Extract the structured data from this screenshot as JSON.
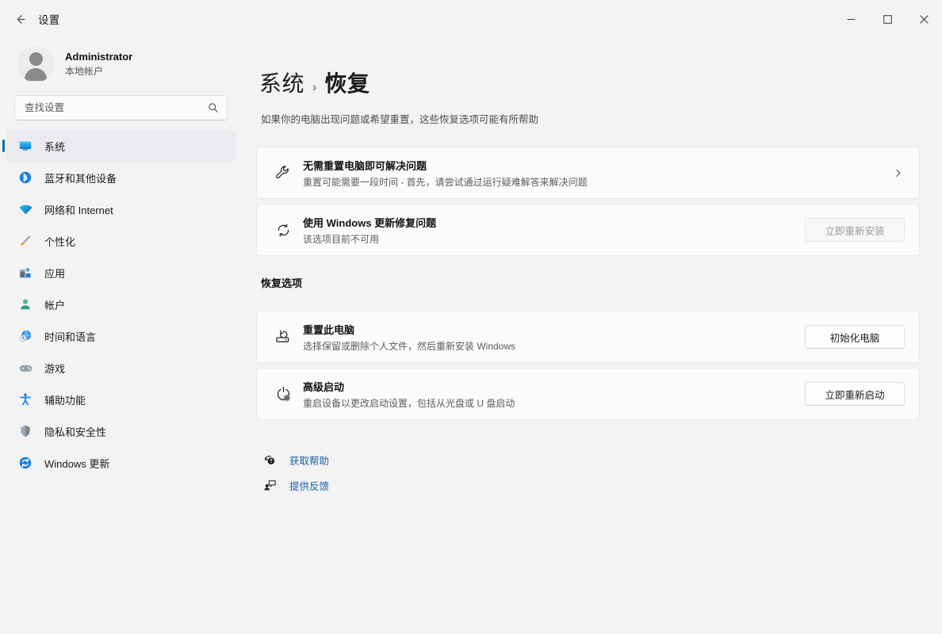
{
  "titlebar": {
    "back_label": "返回",
    "app_title": "设置",
    "minimize_label": "最小化",
    "maximize_label": "最大化",
    "close_label": "关闭"
  },
  "account": {
    "name": "Administrator",
    "subtitle": "本地帐户"
  },
  "search": {
    "placeholder": "查找设置",
    "value": ""
  },
  "sidebar": {
    "items": [
      {
        "label": "系统",
        "icon": "display-icon",
        "selected": true
      },
      {
        "label": "蓝牙和其他设备",
        "icon": "bluetooth-icon",
        "selected": false
      },
      {
        "label": "网络和 Internet",
        "icon": "wifi-icon",
        "selected": false
      },
      {
        "label": "个性化",
        "icon": "paintbrush-icon",
        "selected": false
      },
      {
        "label": "应用",
        "icon": "apps-icon",
        "selected": false
      },
      {
        "label": "帐户",
        "icon": "person-icon",
        "selected": false
      },
      {
        "label": "时间和语言",
        "icon": "clock-globe-icon",
        "selected": false
      },
      {
        "label": "游戏",
        "icon": "gamepad-icon",
        "selected": false
      },
      {
        "label": "辅助功能",
        "icon": "accessibility-icon",
        "selected": false
      },
      {
        "label": "隐私和安全性",
        "icon": "shield-icon",
        "selected": false
      },
      {
        "label": "Windows 更新",
        "icon": "update-refresh-icon",
        "selected": false
      }
    ]
  },
  "page": {
    "breadcrumb_parent": "系统",
    "breadcrumb_separator": "›",
    "breadcrumb_current": "恢复",
    "subtitle": "如果你的电脑出现问题或希望重置，这些恢复选项可能有所帮助"
  },
  "cards": {
    "fix_without_reset": {
      "icon": "wrench-icon",
      "title": "无需重置电脑即可解决问题",
      "subtitle": "重置可能需要一段时间 - 首先，请尝试通过运行疑难解答来解决问题",
      "chevron": "›"
    },
    "fix_with_update": {
      "icon": "refresh-icon",
      "title": "使用 Windows 更新修复问题",
      "subtitle": "该选项目前不可用",
      "button_label": "立即重新安装",
      "button_disabled": true
    }
  },
  "recovery_section": {
    "heading": "恢复选项",
    "items": [
      {
        "icon": "reset-pc-icon",
        "title": "重置此电脑",
        "subtitle": "选择保留或删除个人文件，然后重新安装 Windows",
        "button_label": "初始化电脑"
      },
      {
        "icon": "power-gear-icon",
        "title": "高级启动",
        "subtitle": "重启设备以更改启动设置，包括从光盘或 U 盘启动",
        "button_label": "立即重新启动"
      }
    ]
  },
  "footer_links": [
    {
      "icon": "help-question-icon",
      "label": "获取帮助"
    },
    {
      "icon": "feedback-icon",
      "label": "提供反馈"
    }
  ],
  "colors": {
    "accent": "#0f6cbd",
    "link": "#1d5fa8",
    "window_bg": "#f3f3f3",
    "card_bg": "#fbfbfb"
  }
}
